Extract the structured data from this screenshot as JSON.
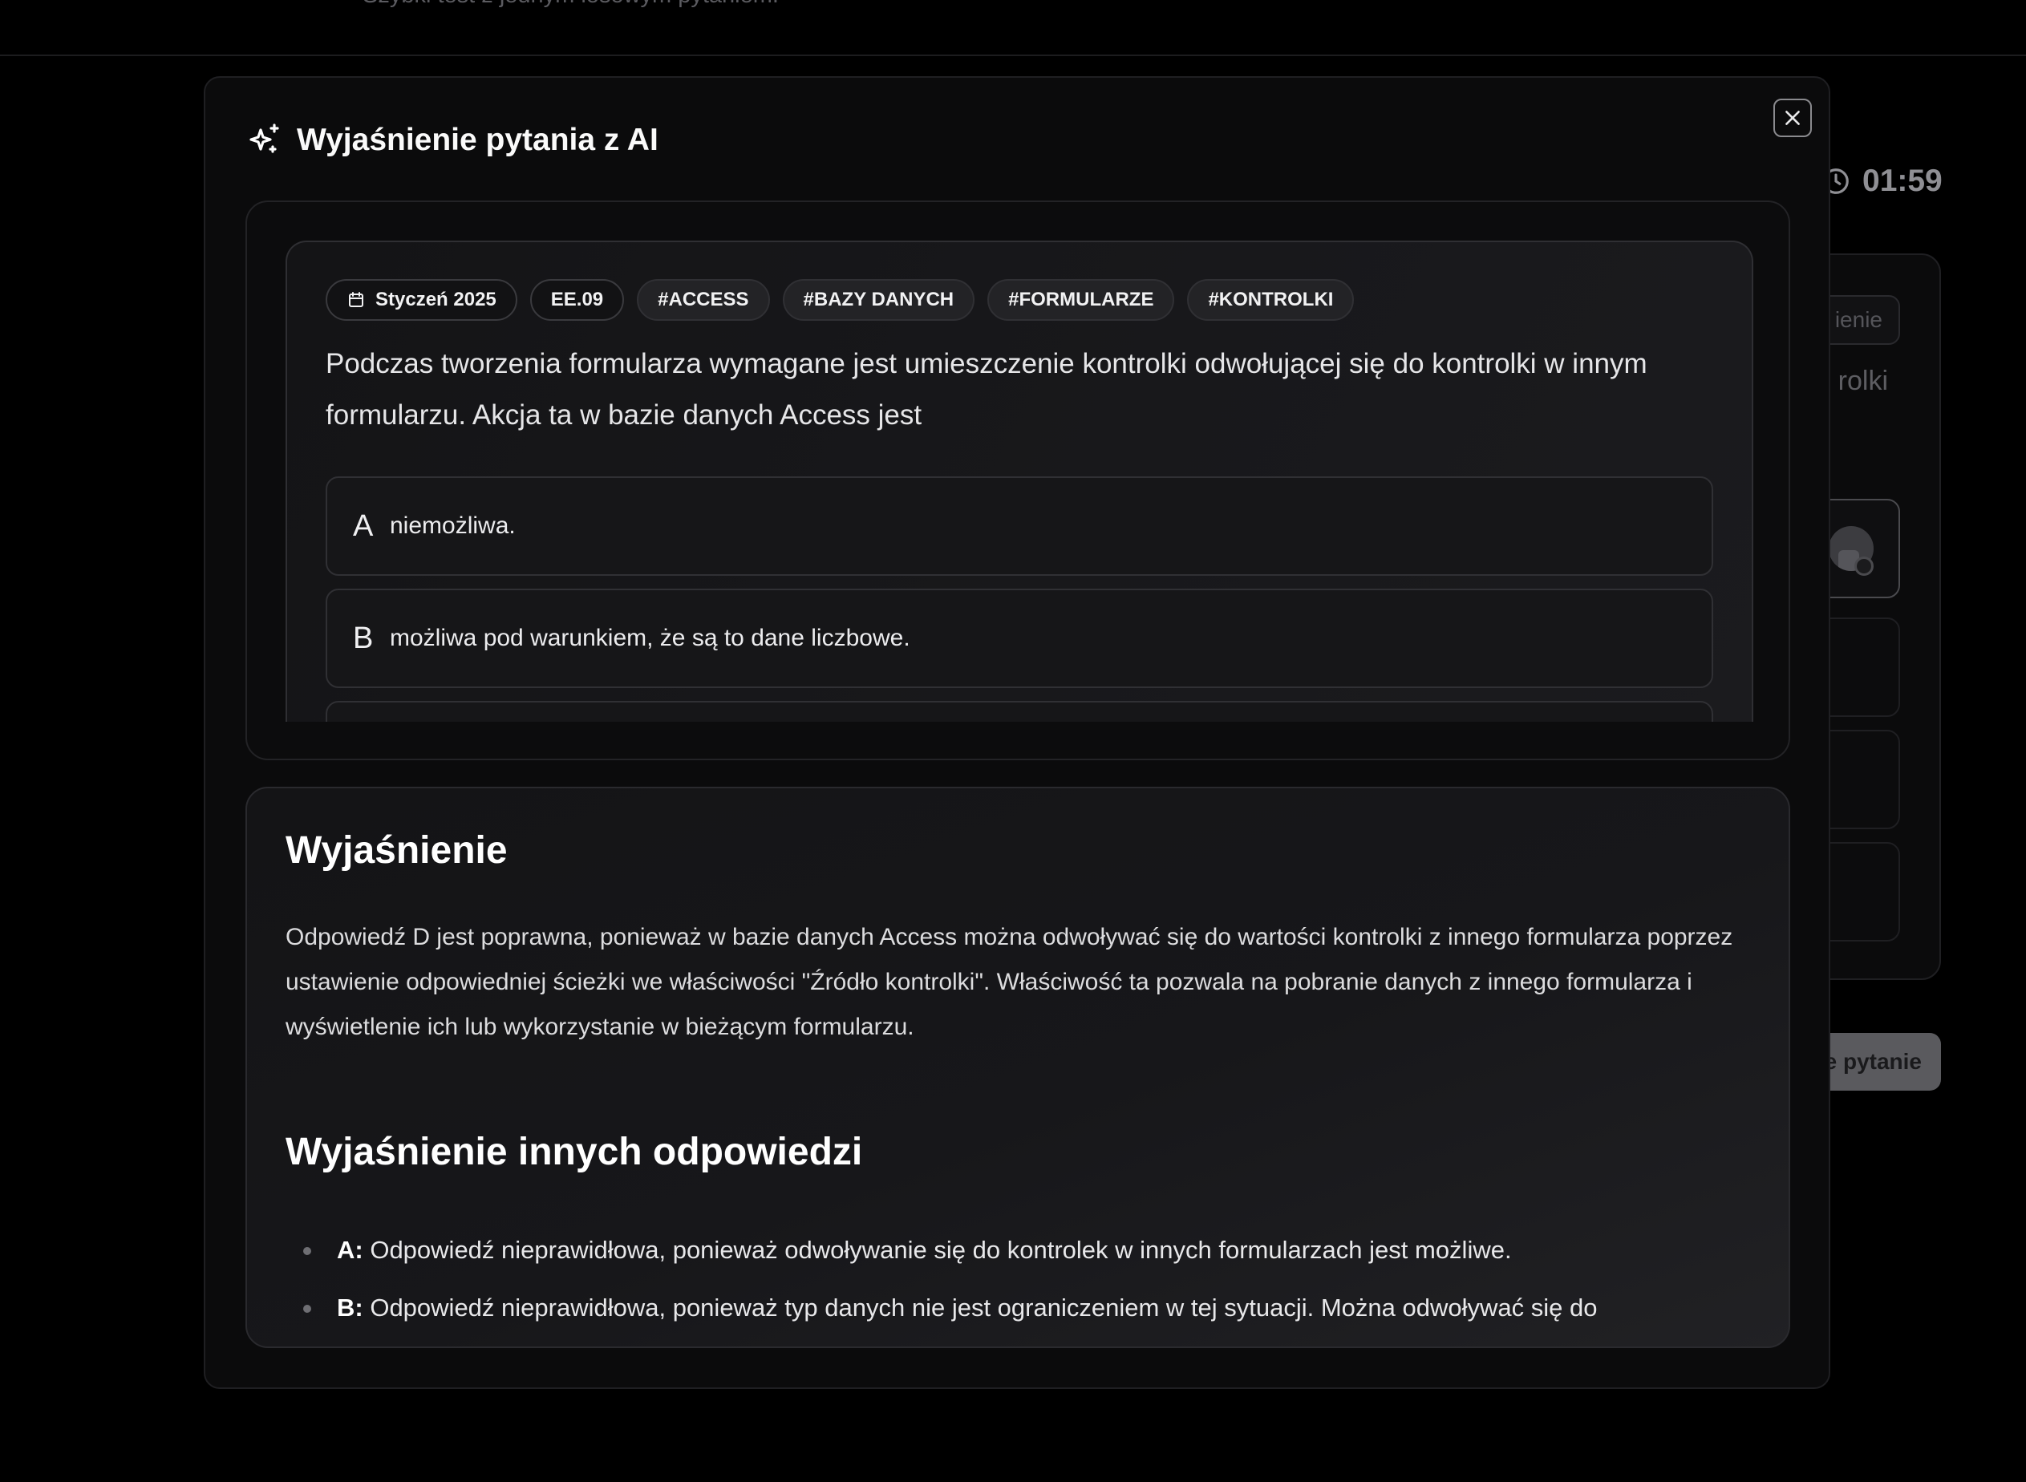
{
  "background": {
    "subtitle": "Szybki test z jednym losowym pytaniem.",
    "timer": "01:59",
    "chip_label": "ienie",
    "text_fragment": "rolki",
    "button_label": "e pytanie"
  },
  "modal": {
    "title": "Wyjaśnienie pytania z AI",
    "tags": [
      {
        "label": "Styczeń 2025",
        "icon": "calendar-icon"
      },
      {
        "label": "EE.09"
      },
      {
        "label": "#ACCESS"
      },
      {
        "label": "#BAZY DANYCH"
      },
      {
        "label": "#FORMULARZE"
      },
      {
        "label": "#KONTROLKI"
      }
    ],
    "question": "Podczas tworzenia formularza wymagane jest umieszczenie kontrolki odwołującej się do kontrolki w innym formularzu. Akcja ta w bazie danych Access jest",
    "options": [
      {
        "letter": "A",
        "text": "niemożliwa."
      },
      {
        "letter": "B",
        "text": "możliwa pod warunkiem, że są to dane liczbowe."
      }
    ],
    "explanation": {
      "heading": "Wyjaśnienie",
      "text": "Odpowiedź D jest poprawna, ponieważ w bazie danych Access można odwoływać się do wartości kontrolki z innego formularza poprzez ustawienie odpowiedniej ścieżki we właściwości \"Źródło kontrolki\". Właściwość ta pozwala na pobranie danych z innego formularza i wyświetlenie ich lub wykorzystanie w bieżącym formularzu.",
      "others_heading": "Wyjaśnienie innych odpowiedzi",
      "others": [
        {
          "letter": "A:",
          "text": " Odpowiedź nieprawidłowa, ponieważ odwoływanie się do kontrolek w innych formularzach jest możliwe."
        },
        {
          "letter": "B:",
          "text": " Odpowiedź nieprawidłowa, ponieważ typ danych nie jest ograniczeniem w tej sytuacji. Można odwoływać się do"
        }
      ]
    }
  },
  "colors": {
    "background": "#000000",
    "modal": "#0b0b0c",
    "card": "#161618",
    "text": "#ffffff"
  }
}
